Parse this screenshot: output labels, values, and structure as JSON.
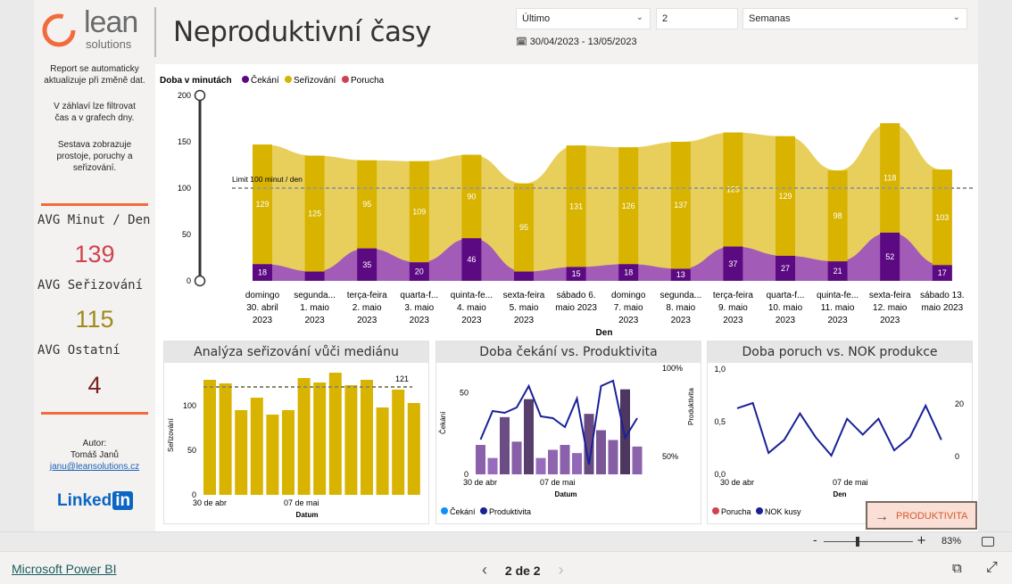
{
  "header": {
    "logo_main": "lean",
    "logo_sub": "solutions",
    "title": "Neproduktivní časy",
    "filter_period": "Último",
    "filter_count": "2",
    "filter_unit": "Semanas",
    "date_range": "30/04/2023 - 13/05/2023"
  },
  "sidebar": {
    "info1": "Report se automaticky aktualizuje při změně dat.",
    "info2": "V záhlaví lze filtrovat čas a v grafech dny.",
    "info3": "Sestava zobrazuje prostoje, poruchy a seřizování.",
    "kpi1_label": "AVG Minut / Den",
    "kpi1_value": "139",
    "kpi2_label": "AVG Seřizování",
    "kpi2_value": "115",
    "kpi3_label": "AVG Ostatní",
    "kpi3_value": "4",
    "author_label": "Autor:",
    "author_name": "Tomáš Janů",
    "author_email": "janu@leansolutions.cz",
    "linkedin_text": "Linked",
    "linkedin_in": "in"
  },
  "colors": {
    "cekani": "#5c0a82",
    "serizovani": "#d8b300",
    "porucha": "#d0424f",
    "orange": "#f26b3a",
    "navy": "#1a2196"
  },
  "chart_data": [
    {
      "type": "bar",
      "title": "",
      "legend_title": "Doba v minutách",
      "legend": [
        "Čekání",
        "Seřizování",
        "Porucha"
      ],
      "xlabel": "Den",
      "ylim": [
        0,
        200
      ],
      "yticks": [
        0,
        50,
        100,
        150,
        200
      ],
      "limit_label": "Limit 100 minut / den",
      "limit_value": 100,
      "categories": [
        [
          "domingo",
          "30. abril",
          "2023"
        ],
        [
          "segunda...",
          "1. maio",
          "2023"
        ],
        [
          "terça-feira",
          "2. maio",
          "2023"
        ],
        [
          "quarta-f...",
          "3. maio",
          "2023"
        ],
        [
          "quinta-fe...",
          "4. maio",
          "2023"
        ],
        [
          "sexta-feira",
          "5. maio",
          "2023"
        ],
        [
          "sábado 6.",
          "maio 2023",
          ""
        ],
        [
          "domingo",
          "7. maio",
          "2023"
        ],
        [
          "segunda...",
          "8. maio",
          "2023"
        ],
        [
          "terça-feira",
          "9. maio",
          "2023"
        ],
        [
          "quarta-f...",
          "10. maio",
          "2023"
        ],
        [
          "quinta-fe...",
          "11. maio",
          "2023"
        ],
        [
          "sexta-feira",
          "12. maio",
          "2023"
        ],
        [
          "sábado 13.",
          "maio 2023",
          ""
        ]
      ],
      "series": [
        {
          "name": "Čekání",
          "values": [
            18,
            10,
            35,
            20,
            46,
            10,
            15,
            18,
            13,
            37,
            27,
            21,
            52,
            17
          ]
        },
        {
          "name": "Seřizování",
          "values": [
            129,
            125,
            95,
            109,
            90,
            95,
            131,
            126,
            137,
            123,
            129,
            98,
            118,
            103
          ]
        }
      ],
      "data_labels_cekani": [
        "18",
        "",
        "35",
        "20",
        "46",
        "",
        "15",
        "18",
        "13",
        "37",
        "27",
        "21",
        "52",
        "17"
      ],
      "data_labels_serizovani": [
        "129",
        "125",
        "95",
        "109",
        "90",
        "95",
        "131",
        "126",
        "137",
        "123",
        "129",
        "98",
        "118",
        "103"
      ]
    },
    {
      "type": "bar",
      "title": "Analýza seřizování vůči mediánu",
      "xlabel": "Datum",
      "ylabel": "Seřizování",
      "ylim": [
        0,
        140
      ],
      "yticks": [
        0,
        50,
        100
      ],
      "xticks": [
        "30 de abr",
        "07 de mai"
      ],
      "median_label": "121",
      "median_value": 121,
      "values": [
        129,
        125,
        95,
        109,
        90,
        95,
        131,
        126,
        137,
        123,
        129,
        98,
        118,
        103
      ]
    },
    {
      "type": "bar",
      "title": "Doba čekání vs. Produktivita",
      "xlabel": "Datum",
      "ylabel": "Čekání",
      "y2label": "Produktivita",
      "ylim": [
        0,
        60
      ],
      "yticks": [
        0,
        50
      ],
      "y2ticks": [
        "100%",
        "50%"
      ],
      "xticks": [
        "30 de abr",
        "07 de mai"
      ],
      "legend": [
        "Čekání",
        "Produktivita"
      ],
      "series": [
        {
          "name": "Čekání",
          "values": [
            18,
            10,
            35,
            20,
            46,
            10,
            15,
            18,
            13,
            37,
            27,
            21,
            52,
            17
          ]
        },
        {
          "name": "Produktivita",
          "values": [
            0.62,
            0.78,
            0.77,
            0.8,
            0.92,
            0.75,
            0.74,
            0.69,
            0.85,
            0.48,
            0.92,
            0.95,
            0.63,
            0.74
          ]
        }
      ]
    },
    {
      "type": "line",
      "title": "Doba poruch vs. NOK produkce",
      "xlabel": "Den",
      "ylabel": "",
      "y2label": "",
      "ylim": [
        0,
        1.0
      ],
      "yticks": [
        "0,0",
        "0,5",
        "1,0"
      ],
      "y2ticks": [
        "0",
        "20"
      ],
      "xticks": [
        "30 de abr",
        "07 de mai"
      ],
      "legend": [
        "Porucha",
        "NOK kusy"
      ],
      "series": [
        {
          "name": "NOK kusy",
          "values": [
            18,
            20,
            1,
            6,
            16,
            7,
            0,
            14,
            8,
            14,
            2,
            7,
            19,
            6
          ]
        }
      ]
    }
  ],
  "nav_button": "PRODUKTIVITA",
  "zoom": {
    "minus": "-",
    "plus": "+",
    "level": "83%"
  },
  "footer": {
    "brand": "Microsoft Power BI",
    "page": "2 de 2",
    "prev": "‹",
    "next": "›"
  }
}
